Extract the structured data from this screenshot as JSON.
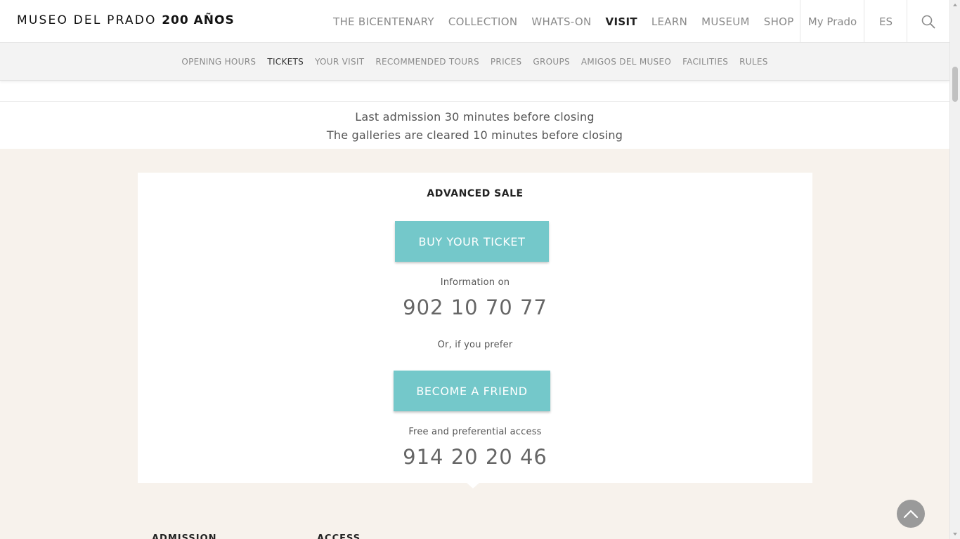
{
  "header": {
    "logo_text": "MUSEO DEL PRADO",
    "logo_bold": "200 AÑOS",
    "nav": [
      {
        "label": "THE BICENTENARY"
      },
      {
        "label": "COLLECTION"
      },
      {
        "label": "WHATS-ON"
      },
      {
        "label": "VISIT",
        "active": true
      },
      {
        "label": "LEARN"
      },
      {
        "label": "MUSEUM"
      },
      {
        "label": "SHOP"
      }
    ],
    "my_prado": "My Prado",
    "language": "ES",
    "search_icon": "search-icon"
  },
  "subnav": {
    "items": [
      {
        "label": "OPENING HOURS"
      },
      {
        "label": "TICKETS",
        "active": true
      },
      {
        "label": "YOUR VISIT"
      },
      {
        "label": "RECOMMENDED TOURS"
      },
      {
        "label": "PRICES"
      },
      {
        "label": "GROUPS"
      },
      {
        "label": "AMIGOS DEL MUSEO"
      },
      {
        "label": "FACILITIES"
      },
      {
        "label": "RULES"
      }
    ]
  },
  "notes": {
    "line1": "Last admission 30 minutes before closing",
    "line2": "The galleries are cleared 10 minutes before closing"
  },
  "advanced_sale": {
    "title": "ADVANCED SALE",
    "buy_button": "BUY YOUR TICKET",
    "info_label": "Information on",
    "info_phone": "902 10 70 77",
    "prefer_label": "Or, if you prefer",
    "friend_button": "BECOME A FRIEND",
    "free_label": "Free and preferential access",
    "friend_phone": "914 20 20 46"
  },
  "bottom": {
    "heading1": "ADMISSION",
    "heading2": "ACCESS"
  },
  "colors": {
    "accent": "#74c8ca",
    "beige_bg": "#f7f2ec",
    "subnav_bg": "#f3f3f3"
  }
}
